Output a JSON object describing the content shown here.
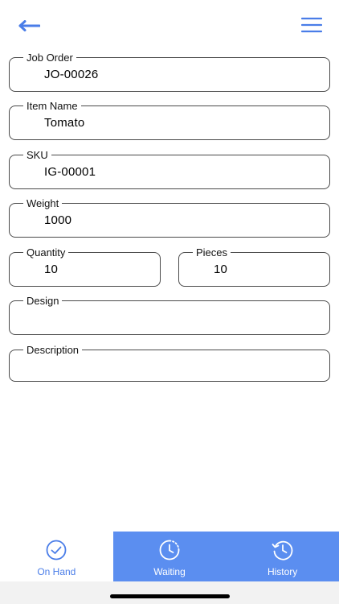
{
  "colors": {
    "accent": "#5b8ef0",
    "active_tab_label": "#4a7de8",
    "field_border": "#4a4a4a"
  },
  "header": {
    "back_icon": "arrow-left-icon",
    "menu_icon": "hamburger-menu-icon"
  },
  "form": {
    "job_order": {
      "label": "Job Order",
      "value": "JO-00026"
    },
    "item_name": {
      "label": "Item Name",
      "value": "Tomato"
    },
    "sku": {
      "label": "SKU",
      "value": "IG-00001"
    },
    "weight": {
      "label": "Weight",
      "value": "1000"
    },
    "quantity": {
      "label": "Quantity",
      "value": "10"
    },
    "pieces": {
      "label": "Pieces",
      "value": "10"
    },
    "design": {
      "label": "Design",
      "value": ""
    },
    "description": {
      "label": "Description",
      "value": ""
    }
  },
  "tabs": [
    {
      "label": "On Hand",
      "icon": "check-circle-icon",
      "active": true
    },
    {
      "label": "Waiting",
      "icon": "clock-waiting-icon",
      "active": false
    },
    {
      "label": "History",
      "icon": "history-icon",
      "active": false
    }
  ]
}
